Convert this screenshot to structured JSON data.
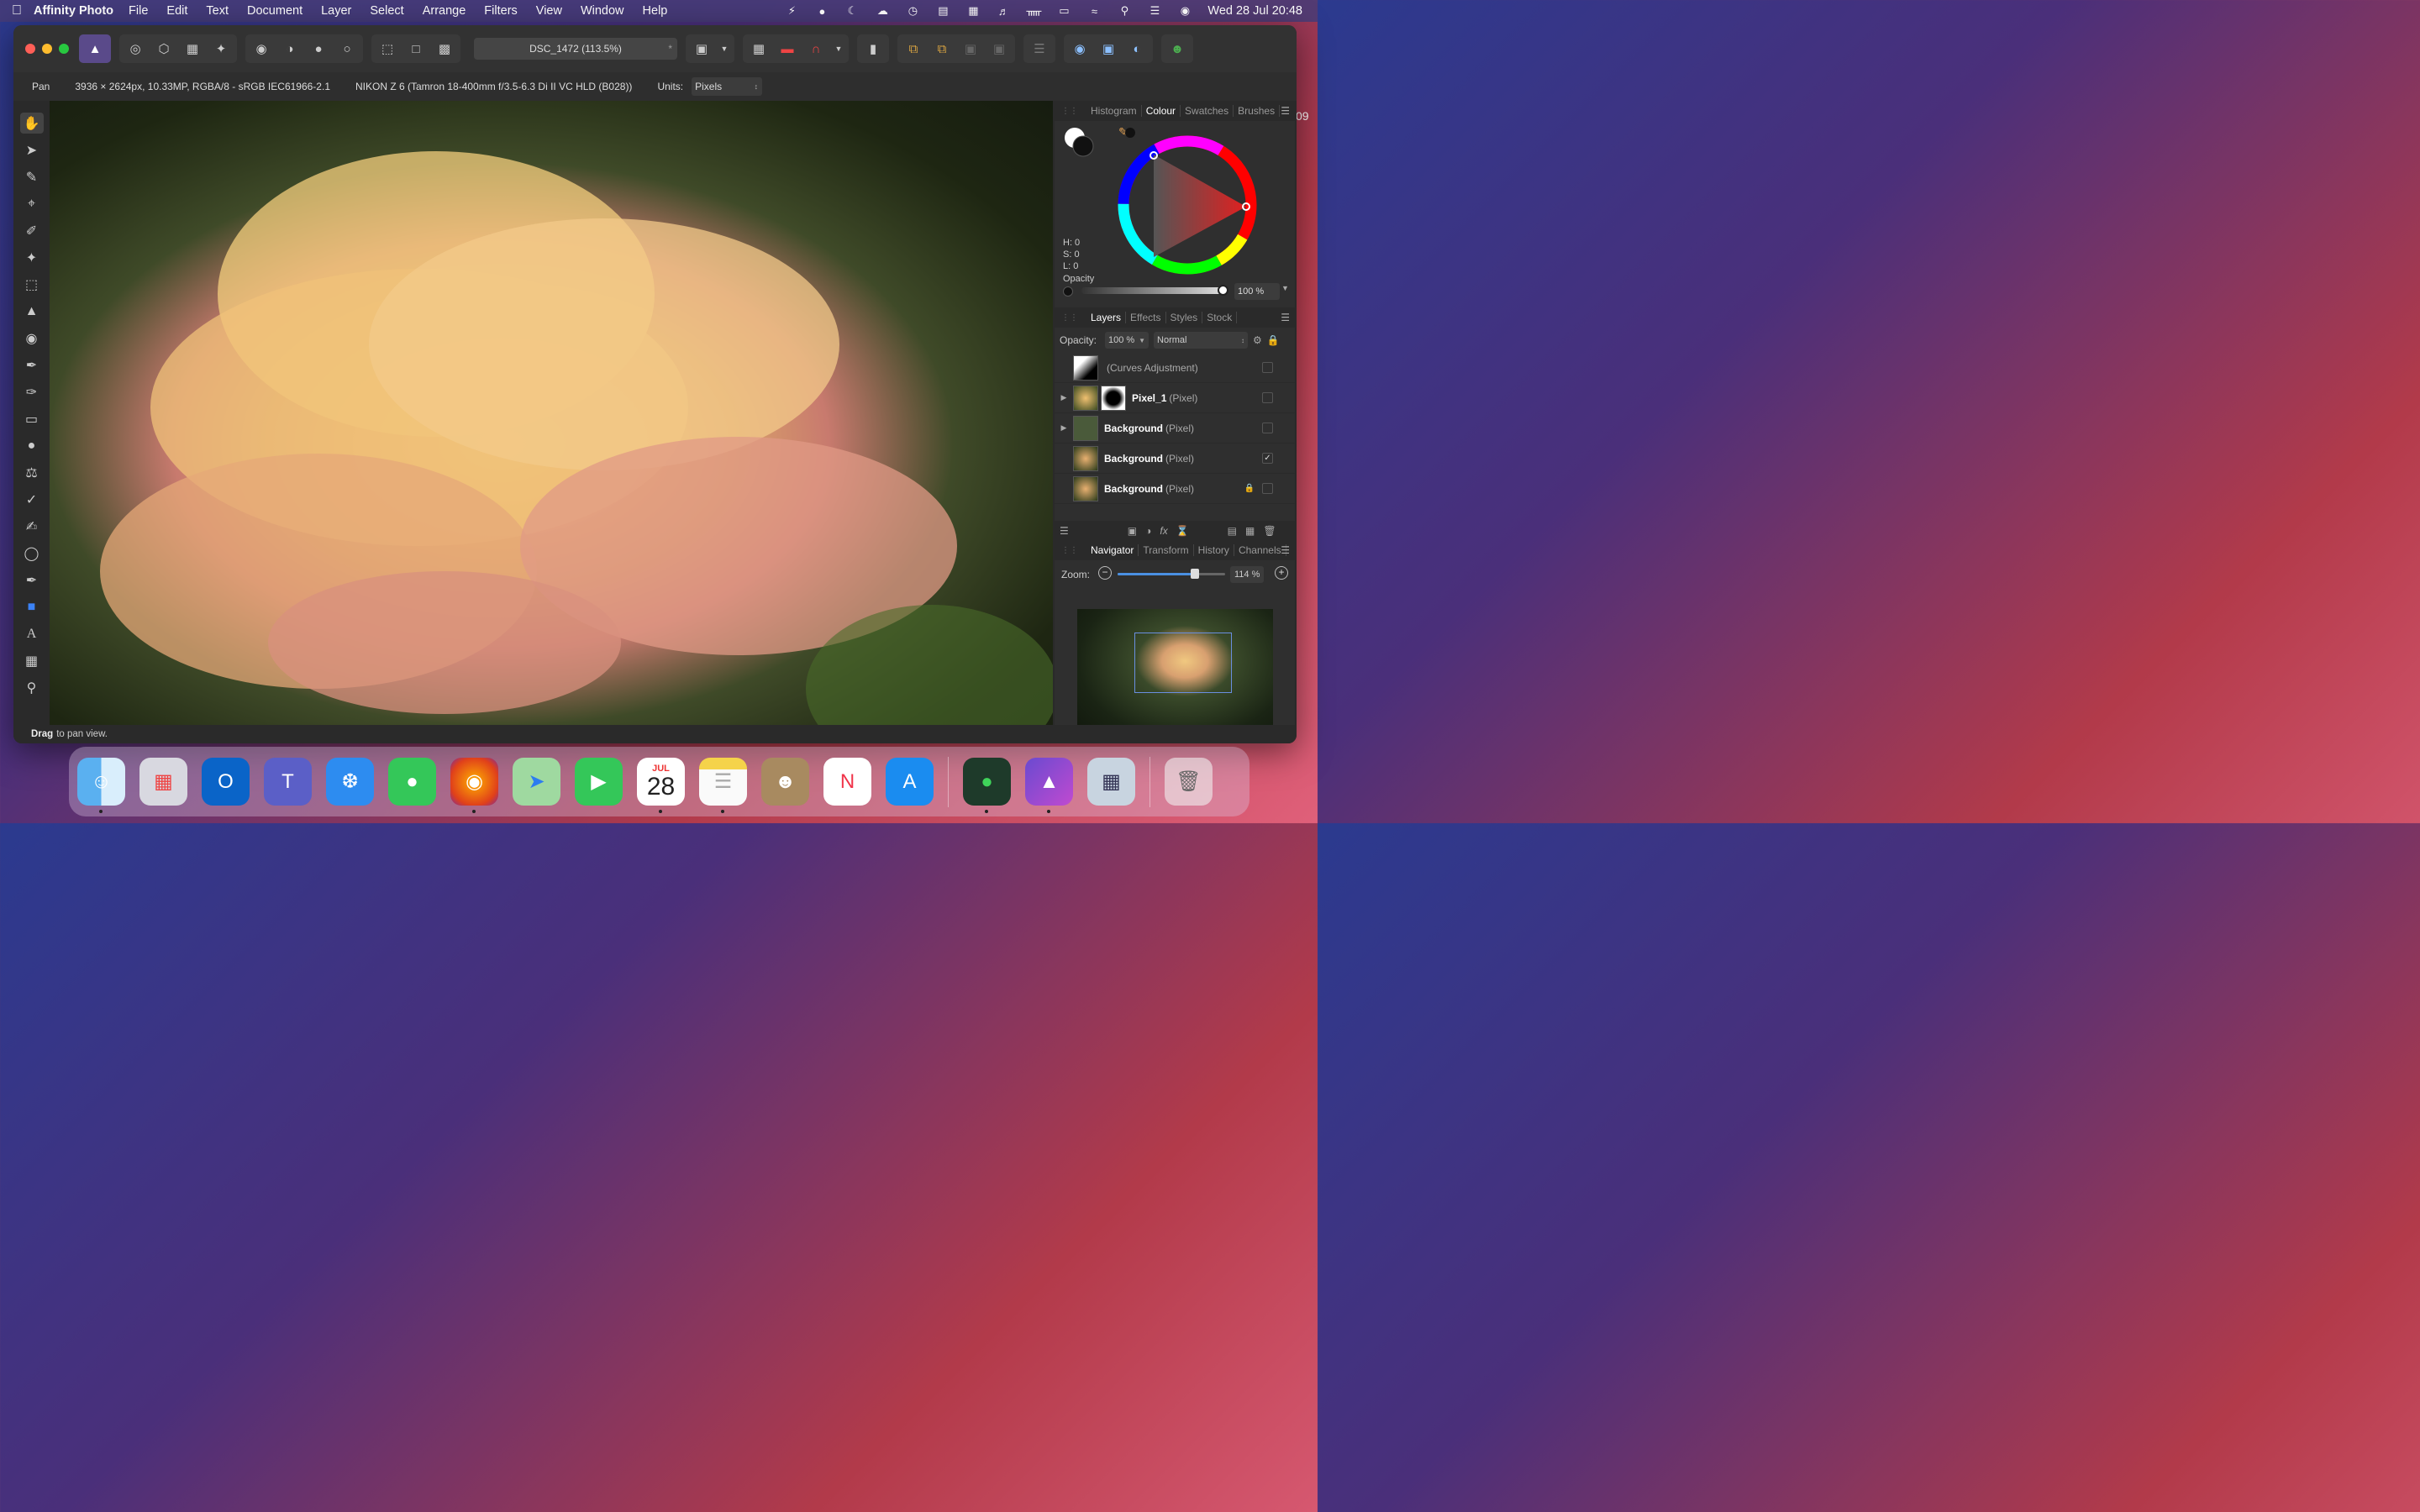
{
  "menubar": {
    "app_name": "Affinity Photo",
    "items": [
      "File",
      "Edit",
      "Text",
      "Document",
      "Layer",
      "Select",
      "Arrange",
      "Filters",
      "View",
      "Window",
      "Help"
    ],
    "clock": "Wed 28 Jul  20:48"
  },
  "toolbar": {
    "document_title": "DSC_1472 (113.5%)",
    "modified_marker": "*"
  },
  "context": {
    "tool_name": "Pan",
    "image_info": "3936 × 2624px, 10.33MP, RGBA/8 - sRGB IEC61966-2.1",
    "camera_info": "NIKON Z 6 (Tamron 18-400mm f/3.5-6.3 Di II VC HLD (B028))",
    "units_label": "Units:",
    "units_value": "Pixels"
  },
  "status": {
    "bold": "Drag",
    "text": "to pan view."
  },
  "colour_panel": {
    "tabs": [
      "Histogram",
      "Colour",
      "Swatches",
      "Brushes"
    ],
    "active_tab": "Colour",
    "h": "H: 0",
    "s": "S: 0",
    "l": "L: 0",
    "opacity_label": "Opacity",
    "opacity_value": "100 %"
  },
  "layers_panel": {
    "tabs": [
      "Layers",
      "Effects",
      "Styles",
      "Stock"
    ],
    "active_tab": "Layers",
    "opacity_label": "Opacity:",
    "opacity_value": "100 %",
    "blend_mode": "Normal",
    "layers": [
      {
        "name": "",
        "type": "(Curves Adjustment)",
        "checked": false,
        "locked": false,
        "expandable": false
      },
      {
        "name": "Pixel_1",
        "type": "(Pixel)",
        "checked": false,
        "locked": false,
        "expandable": true
      },
      {
        "name": "Background",
        "type": "(Pixel)",
        "checked": false,
        "locked": false,
        "expandable": true
      },
      {
        "name": "Background",
        "type": "(Pixel)",
        "checked": true,
        "locked": false,
        "expandable": false
      },
      {
        "name": "Background",
        "type": "(Pixel)",
        "checked": false,
        "locked": true,
        "expandable": false
      }
    ]
  },
  "navigator_panel": {
    "tabs": [
      "Navigator",
      "Transform",
      "History",
      "Channels"
    ],
    "active_tab": "Navigator",
    "zoom_label": "Zoom:",
    "zoom_value": "114 %",
    "zoom_fraction": 0.72
  },
  "dock": {
    "calendar_month": "JUL",
    "calendar_day": "28",
    "apps": [
      "finder-icon",
      "launchpad-icon",
      "outlook-icon",
      "teams-icon",
      "safari-icon",
      "messages-icon",
      "firefox-icon",
      "maps-icon",
      "facetime-icon",
      "calendar-icon",
      "notes-icon",
      "contacts-icon",
      "news-icon",
      "app-store-icon",
      "chat-icon",
      "affinity-photo-icon",
      "preview-icon",
      "trash-icon"
    ]
  },
  "side_text": "09"
}
